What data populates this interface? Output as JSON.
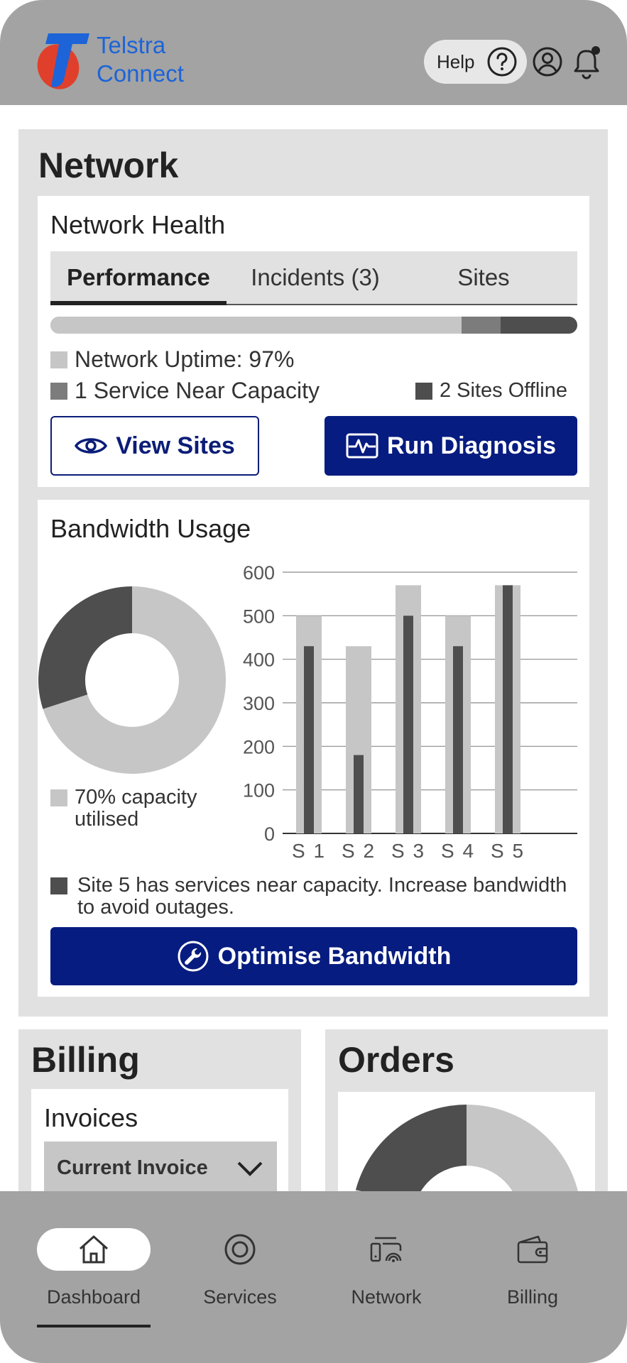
{
  "header": {
    "brand_line1": "Telstra",
    "brand_line2": "Connect",
    "help_label": "Help",
    "brand_color": "#1c64d8",
    "logo_blue": "#1c64d8",
    "logo_red": "#e0402b"
  },
  "network": {
    "title": "Network",
    "health": {
      "title": "Network Health",
      "tabs": [
        {
          "label": "Performance",
          "active": true
        },
        {
          "label": "Incidents (3)",
          "active": false
        },
        {
          "label": "Sites",
          "active": false
        }
      ],
      "bar_segments": [
        {
          "fraction": 0.78,
          "color": "#c6c6c6"
        },
        {
          "fraction": 0.075,
          "color": "#7c7c7c"
        },
        {
          "fraction": 0.145,
          "color": "#4e4e4e"
        }
      ],
      "legend": [
        {
          "label": "Network Uptime: 97%",
          "color": "#c6c6c6"
        },
        {
          "label": "1 Service Near Capacity",
          "color": "#7c7c7c"
        },
        {
          "label": "2 Sites Offline",
          "color": "#4e4e4e"
        }
      ],
      "view_sites_label": "View Sites",
      "run_diagnosis_label": "Run Diagnosis"
    },
    "bandwidth": {
      "title": "Bandwidth Usage",
      "donut_legend": "70% capacity utilised",
      "note": "Site 5 has services near capacity. Increase bandwidth to avoid outages.",
      "optimise_label": "Optimise Bandwidth"
    }
  },
  "chart_data": [
    {
      "type": "pie",
      "donut": true,
      "slices": [
        {
          "name": "70% capacity utilised",
          "value": 70,
          "color": "#c6c6c6"
        },
        {
          "value": 30,
          "color": "#4e4e4e"
        }
      ]
    },
    {
      "type": "bar",
      "categories": [
        "S 1",
        "S 2",
        "S 3",
        "S 4",
        "S 5"
      ],
      "series": [
        {
          "values": [
            500,
            430,
            570,
            500,
            570
          ],
          "color": "#c6c6c6"
        },
        {
          "values": [
            430,
            180,
            500,
            430,
            570
          ],
          "color": "#4e4e4e"
        }
      ],
      "yticks": [
        "0",
        "100",
        "200",
        "300",
        "400",
        "500",
        "600"
      ],
      "ylim": [
        0,
        600
      ],
      "grid": true
    }
  ],
  "billing": {
    "title": "Billing",
    "invoices_title": "Invoices",
    "select_value": "Current Invoice"
  },
  "orders": {
    "title": "Orders",
    "donut_colors": [
      "#c6c6c6",
      "#4e4e4e"
    ]
  },
  "bottom_nav": [
    {
      "label": "Dashboard",
      "icon": "home-icon",
      "active": true
    },
    {
      "label": "Services",
      "icon": "services-icon",
      "active": false
    },
    {
      "label": "Network",
      "icon": "network-icon",
      "active": false
    },
    {
      "label": "Billing",
      "icon": "wallet-icon",
      "active": false
    }
  ],
  "colors": {
    "header_bg": "#a3a3a3",
    "section_bg": "#e1e1e1",
    "primary": "#061c80"
  }
}
